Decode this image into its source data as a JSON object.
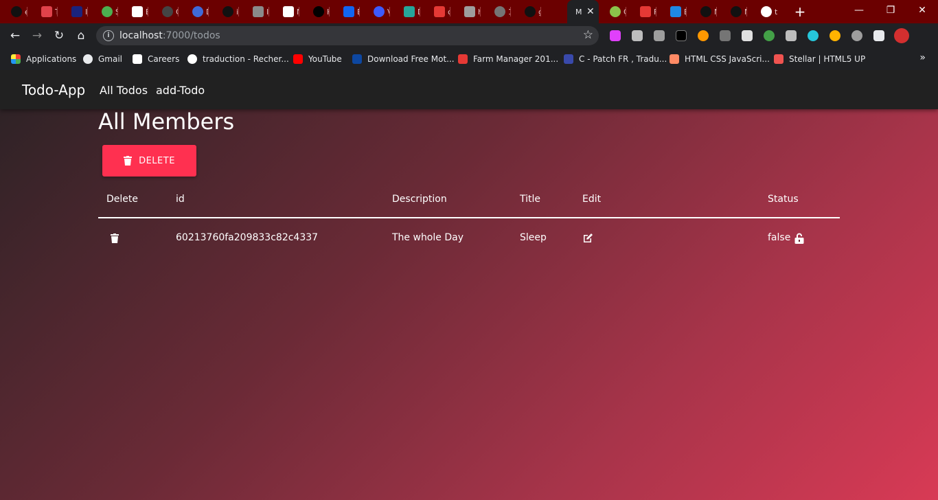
{
  "browser": {
    "tabs": [
      {
        "title": "e",
        "favicon": "github-icon",
        "color": "#000000"
      },
      {
        "title": "Tr",
        "favicon": "slash-icon",
        "color": "#e0424a"
      },
      {
        "title": "In",
        "favicon": "in-icon",
        "color": "#1a237e"
      },
      {
        "title": "S",
        "favicon": "circle-icon",
        "color": "#4caf50"
      },
      {
        "title": "E",
        "favicon": "ex-icon",
        "color": "#ffffff"
      },
      {
        "title": "C",
        "favicon": "compass-icon",
        "color": "#2d2d2d"
      },
      {
        "title": "D",
        "favicon": "c-icon",
        "color": "#3f6ad8"
      },
      {
        "title": "ia",
        "favicon": "github-icon",
        "color": "#000000"
      },
      {
        "title": "In",
        "favicon": "link-icon",
        "color": "#8a8a8a"
      },
      {
        "title": "N",
        "favicon": "m-icon",
        "color": "#ffffff"
      },
      {
        "title": "H",
        "favicon": "medium-icon",
        "color": "#000000"
      },
      {
        "title": "B",
        "favicon": "mdb-icon",
        "color": "#1266f1"
      },
      {
        "title": "V",
        "favicon": "flask-icon",
        "color": "#3d5afe"
      },
      {
        "title": "D",
        "favicon": "diamond-icon",
        "color": "#26a69a"
      },
      {
        "title": "c",
        "favicon": "n-icon",
        "color": "#e53935"
      },
      {
        "title": "h",
        "favicon": "printer-icon",
        "color": "#9e9e9e"
      },
      {
        "title": "1",
        "favicon": "globe-icon",
        "color": "#757575"
      },
      {
        "title": "g",
        "favicon": "github-icon",
        "color": "#000000"
      },
      {
        "title": "M",
        "favicon": "",
        "color": "#202124"
      },
      {
        "title": "C",
        "favicon": "sparkle-icon",
        "color": "#8bc34a"
      },
      {
        "title": "F",
        "favicon": "z-icon",
        "color": "#e53935"
      },
      {
        "title": "E",
        "favicon": "flag-icon",
        "color": "#1e88e5"
      },
      {
        "title": "N",
        "favicon": "github-icon",
        "color": "#000000"
      },
      {
        "title": "N",
        "favicon": "github-icon",
        "color": "#000000"
      },
      {
        "title": "t",
        "favicon": "google-icon",
        "color": "#ffffff"
      }
    ],
    "close_tab_glyph": "✕",
    "new_tab_glyph": "+",
    "window_controls": {
      "minimize": "—",
      "restore": "❐",
      "close": "✕"
    },
    "nav": {
      "back": "←",
      "forward": "→",
      "reload": "↻",
      "home": "⌂"
    },
    "url": {
      "host": "localhost",
      "path": ":7000/todos"
    },
    "star_glyph": "☆",
    "extensions": [
      {
        "name": "color-picker-icon",
        "color": "#e040fb"
      },
      {
        "name": "function-icon",
        "color": "#bdbdbd"
      },
      {
        "name": "camera-icon",
        "color": "#9e9e9e"
      },
      {
        "name": "keyboard-icon",
        "color": "#000000"
      },
      {
        "name": "owl-icon",
        "color": "#ff9800"
      },
      {
        "name": "microphone-icon",
        "color": "#757575"
      },
      {
        "name": "shield-icon",
        "color": "#e0e0e0"
      },
      {
        "name": "earth-icon",
        "color": "#43a047"
      },
      {
        "name": "help-shield-icon",
        "color": "#bdbdbd"
      },
      {
        "name": "m-circle-icon",
        "color": "#26c6da"
      },
      {
        "name": "fire-icon",
        "color": "#ffb300"
      },
      {
        "name": "hat-icon",
        "color": "#9e9e9e"
      },
      {
        "name": "puzzle-icon",
        "color": "#e8eaed"
      },
      {
        "name": "profile-avatar-icon",
        "color": "#d32f2f"
      }
    ],
    "bookmarks": [
      {
        "label": "Applications",
        "icon": "apps-grid-icon",
        "color": "#f44336"
      },
      {
        "label": "Gmail",
        "icon": "globe-icon",
        "color": "#e8eaed"
      },
      {
        "label": "Careers",
        "icon": "a-icon",
        "color": "#ffffff"
      },
      {
        "label": "traduction - Recher...",
        "icon": "google-icon",
        "color": "#ffffff"
      },
      {
        "label": "YouTube",
        "icon": "youtube-icon",
        "color": "#ff0000"
      },
      {
        "label": "Download Free Mot...",
        "icon": "v-icon",
        "color": "#0d47a1"
      },
      {
        "label": "Farm Manager 201...",
        "icon": "gamepad-icon",
        "color": "#e53935"
      },
      {
        "label": "C - Patch FR , Tradu...",
        "icon": "patch-icon",
        "color": "#3949ab"
      },
      {
        "label": "HTML CSS JavaScri...",
        "icon": "person-icon",
        "color": "#ff8a65"
      },
      {
        "label": "Stellar | HTML5 UP",
        "icon": "html5up-icon",
        "color": "#ef5350"
      }
    ],
    "bookmarks_more": "»"
  },
  "app": {
    "brand": "Todo-App",
    "nav_links": [
      "All Todos",
      "add-Todo"
    ],
    "page_title": "All Members",
    "delete_button_label": "DELETE",
    "table": {
      "headers": [
        "Delete",
        "id",
        "Description",
        "Title",
        "Edit",
        "Status"
      ],
      "rows": [
        {
          "id": "60213760fa209833c82c4337",
          "description": "The whole Day",
          "title": "Sleep",
          "status": "false"
        }
      ]
    }
  },
  "colors": {
    "tab_strip": "#6b0000",
    "chrome": "#202124",
    "app_nav": "#212121",
    "delete_button": "#ff3050",
    "gradient_start": "#2a2225",
    "gradient_end": "#d83a55"
  }
}
